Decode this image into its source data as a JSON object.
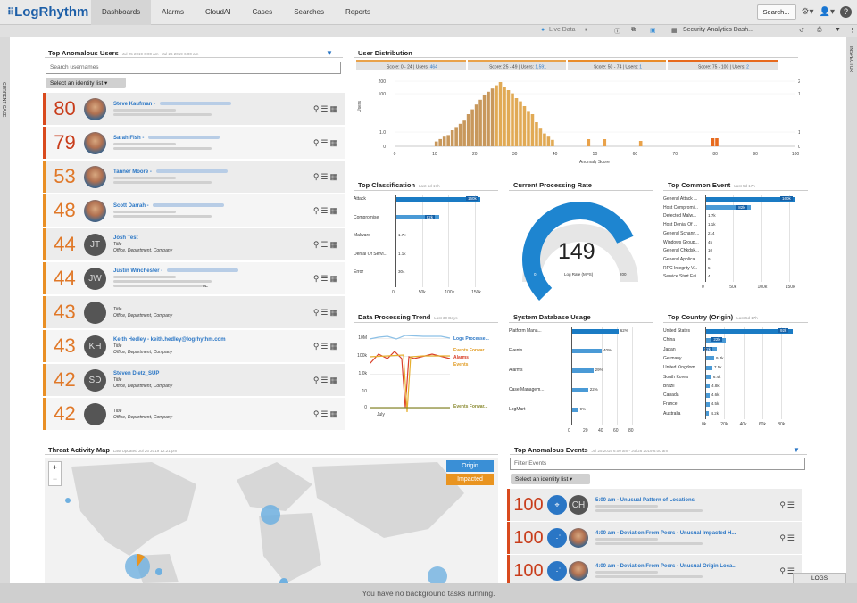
{
  "app": {
    "brand": "LogRhythm",
    "nav": [
      "Dashboards",
      "Alarms",
      "CloudAI",
      "Cases",
      "Searches",
      "Reports"
    ],
    "search_label": "Search..."
  },
  "subbar": {
    "live": "Live Data",
    "layout": "Security Analytics Dash..."
  },
  "rails": {
    "left": "CURRENT CASE",
    "right": "INSPECTOR"
  },
  "users": {
    "title": "Top Anomalous Users",
    "range": "Jul 25 2019 6:00 am - Jul 26 2019 6:00 am",
    "search_placeholder": "Search usernames",
    "select": "Select an identity list ▾",
    "rows": [
      {
        "score": "80",
        "name": "Steve Kaufman - ",
        "initials": "",
        "photo": true
      },
      {
        "score": "79",
        "name": "Sarah Fish - ",
        "initials": "",
        "photo": true
      },
      {
        "score": "53",
        "name": "Tanner Moore - ",
        "initials": "",
        "photo": true
      },
      {
        "score": "48",
        "name": "Scott Darrah - ",
        "initials": "",
        "photo": true
      },
      {
        "score": "44",
        "name": "Josh Test",
        "initials": "JT",
        "l1": "Title",
        "l2": "Office, Department, Company"
      },
      {
        "score": "44",
        "name": "Justin Winchester - ",
        "initials": "JW",
        "photo": false,
        "l2": "nc."
      },
      {
        "score": "43",
        "name": "",
        "initials": "",
        "l1": "Title",
        "l2": "Office, Department, Company"
      },
      {
        "score": "43",
        "name": "Keith Hedley - keith.hedley@logrhythm.com",
        "initials": "KH",
        "l1": "Title",
        "l2": "Office, Department, Company"
      },
      {
        "score": "42",
        "name": "Steven Dietz_SUP",
        "initials": "SD",
        "l1": "Title",
        "l2": "Office, Department, Company"
      },
      {
        "score": "42",
        "name": "",
        "initials": "",
        "l1": "Title",
        "l2": "Office, Department, Company"
      }
    ]
  },
  "distribution": {
    "title": "User Distribution",
    "ylabel": "Users",
    "xlabel": "Anomaly Score",
    "buckets": [
      {
        "range": "Score: 0 - 24",
        "users_label": "Users:",
        "users": "464"
      },
      {
        "range": "Score: 25 - 49",
        "users_label": "Users:",
        "users": "1,591"
      },
      {
        "range": "Score: 50 - 74",
        "users_label": "Users:",
        "users": "1"
      },
      {
        "range": "Score: 75 - 100",
        "users_label": "Users:",
        "users": "2"
      }
    ],
    "yticks": [
      "200",
      "100",
      "1.0",
      "0"
    ],
    "xticks": [
      "0",
      "10",
      "20",
      "30",
      "40",
      "50",
      "60",
      "70",
      "80",
      "90",
      "100"
    ]
  },
  "classification": {
    "title": "Top Classification",
    "sub": "Last 5d 17h",
    "labels": [
      "Attack",
      "Compromise",
      "Malware",
      "Denial Of Servi...",
      "Error"
    ],
    "values": [
      "160k",
      "82k",
      "1.7k",
      "1.1k",
      "304"
    ],
    "xticks": [
      "0",
      "50k",
      "100k",
      "150k"
    ]
  },
  "rate": {
    "title": "Current Processing Rate",
    "value": "149",
    "label": "Log Rate (MPS)",
    "min": "0",
    "max": "200"
  },
  "common": {
    "title": "Top Common Event",
    "sub": "Last 5d 17h",
    "labels": [
      "General Attack ...",
      "Host Compromi...",
      "Detected Malw...",
      "Host Denial Of ...",
      "General Schann...",
      "Windows Group...",
      "General Chkdsk...",
      "General Applica...",
      "RPC Integrity V...",
      "Service Start Fai..."
    ],
    "values": [
      "160k",
      "82k",
      "1.7k",
      "1.1k",
      "214",
      "45",
      "10",
      "9",
      "5",
      "4"
    ],
    "xticks": [
      "0",
      "50k",
      "100k",
      "150k"
    ]
  },
  "trend": {
    "title": "Data Processing Trend",
    "sub": "Last 30 Days",
    "yticks": [
      "10M",
      "100k",
      "1.0k",
      "10",
      "0"
    ],
    "xlabel": "July",
    "series": [
      "Logs Processe...",
      "Events Forwar...",
      "Alarms",
      "Events",
      "Events Forwar..."
    ]
  },
  "db": {
    "title": "System Database Usage",
    "labels": [
      "Platform Mana...",
      "Events",
      "Alarms",
      "Case Managem...",
      "LogMart"
    ],
    "values": [
      "62%",
      "40%",
      "29%",
      "22%",
      "9%"
    ],
    "xticks": [
      "0",
      "20",
      "40",
      "60",
      "80"
    ]
  },
  "country": {
    "title": "Top Country (Origin)",
    "sub": "Last 5d 17h",
    "labels": [
      "United States",
      "China",
      "Japan",
      "Germany",
      "United Kingdom",
      "South Korea",
      "Brazil",
      "Canada",
      "France",
      "Australia"
    ],
    "values": [
      "92k",
      "22k",
      "12k",
      "9.4k",
      "7.5k",
      "6.4k",
      "4.8k",
      "4.6k",
      "4.5k",
      "4.2k"
    ],
    "xticks": [
      "0k",
      "20k",
      "40k",
      "60k",
      "80k"
    ]
  },
  "map": {
    "title": "Threat Activity Map",
    "sub": "Last Updated Jul 26 2019 12:21 pm",
    "origin": "Origin",
    "impacted": "Impacted",
    "zoom_in": "+",
    "zoom_out": "−"
  },
  "events": {
    "title": "Top Anomalous Events",
    "range": "Jul 25 2019 6:00 am - Jul 26 2019 6:00 am",
    "filter_placeholder": "Filter Events",
    "select": "Select an identity list ▾",
    "rows": [
      {
        "score": "100",
        "name": "5:00 am - Unusual Pattern of Locations",
        "initials": "CH"
      },
      {
        "score": "100",
        "name": "4:00 am - Deviation From Peers - Unusual Impacted H...",
        "initials": ""
      },
      {
        "score": "100",
        "name": "4:00 am - Deviation From Peers - Unusual Origin Loca...",
        "initials": ""
      }
    ]
  },
  "status": {
    "text": "You have no background tasks running.",
    "logs": "LOGS"
  }
}
